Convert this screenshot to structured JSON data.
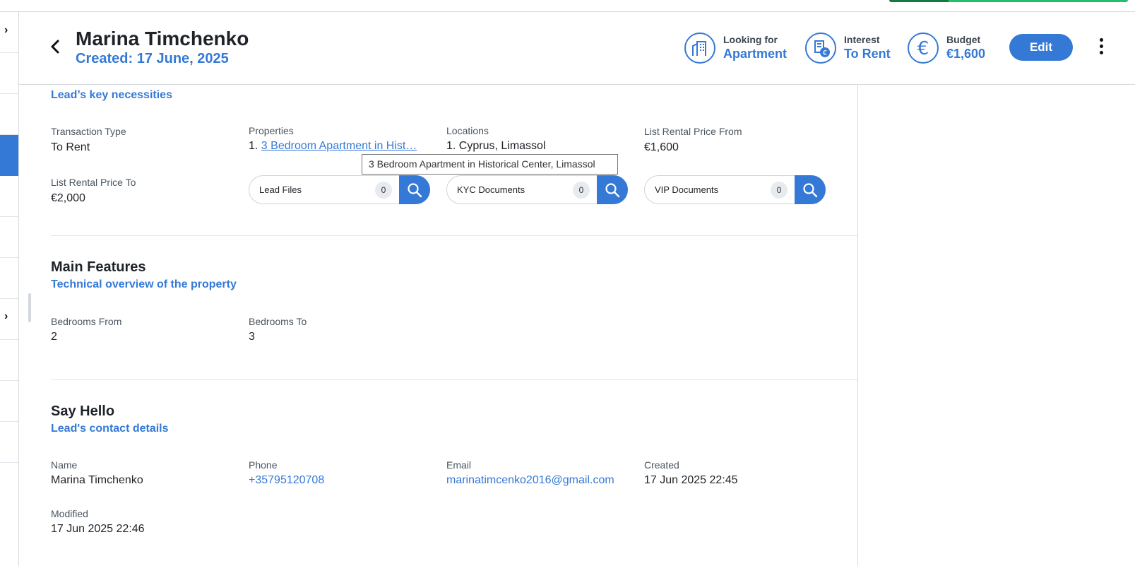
{
  "header": {
    "title": "Marina Timchenko",
    "created": "Created: 17 June, 2025",
    "stats": [
      {
        "label": "Looking for",
        "value": "Apartment",
        "icon": "building-icon"
      },
      {
        "label": "Interest",
        "value": "To Rent",
        "icon": "rent-icon"
      },
      {
        "label": "Budget",
        "value": "€1,600",
        "icon": "euro-icon"
      }
    ],
    "edit_label": "Edit"
  },
  "needs": {
    "subtitle": "Lead’s key necessities",
    "transaction_type_label": "Transaction Type",
    "transaction_type_value": "To Rent",
    "properties_label": "Properties",
    "properties_index": "1.",
    "properties_value": "3 Bedroom Apartment in Hist…",
    "locations_label": "Locations",
    "locations_value": "1. Cyprus, Limassol",
    "price_from_label": "List Rental Price From",
    "price_from_value": "€1,600",
    "price_to_label": "List Rental Price To",
    "price_to_value": "€2,000",
    "docs": [
      {
        "label": "Lead Files",
        "count": "0"
      },
      {
        "label": "KYC Documents",
        "count": "0"
      },
      {
        "label": "VIP Documents",
        "count": "0"
      }
    ],
    "tooltip": "3 Bedroom Apartment in Historical Center, Limassol"
  },
  "features": {
    "title": "Main Features",
    "subtitle": "Technical overview of the property",
    "bedrooms_from_label": "Bedrooms From",
    "bedrooms_from_value": "2",
    "bedrooms_to_label": "Bedrooms To",
    "bedrooms_to_value": "3"
  },
  "contact": {
    "title": "Say Hello",
    "subtitle": "Lead's contact details",
    "name_label": "Name",
    "name_value": "Marina Timchenko",
    "phone_label": "Phone",
    "phone_value": "+35795120708",
    "email_label": "Email",
    "email_value": "marinatimcenko2016@gmail.com",
    "created_label": "Created",
    "created_value": "17 Jun 2025 22:45",
    "modified_label": "Modified",
    "modified_value": "17 Jun 2025 22:46"
  },
  "colors": {
    "accent": "#3479d6",
    "progress_green": "#22c068"
  }
}
